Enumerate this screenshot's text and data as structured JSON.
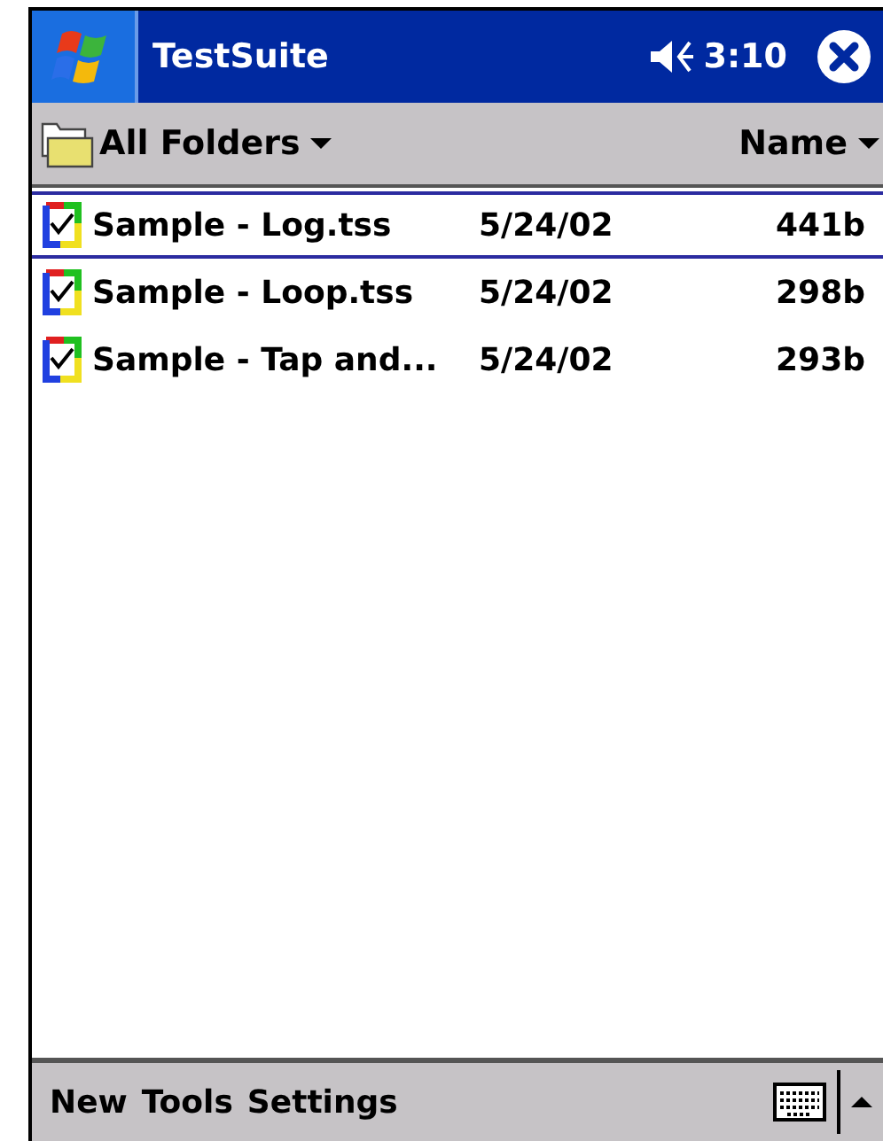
{
  "title_bar": {
    "title": "TestSuite",
    "time": "3:10"
  },
  "toolbar": {
    "folder": "All Folders",
    "sort": "Name"
  },
  "files": [
    {
      "name": "Sample - Log.tss",
      "date": "5/24/02",
      "size": "441b",
      "selected": true
    },
    {
      "name": "Sample - Loop.tss",
      "date": "5/24/02",
      "size": "298b",
      "selected": false
    },
    {
      "name": "Sample - Tap and...",
      "date": "5/24/02",
      "size": "293b",
      "selected": false
    }
  ],
  "menu_bar": {
    "items": [
      "New",
      "Tools",
      "Settings"
    ]
  }
}
